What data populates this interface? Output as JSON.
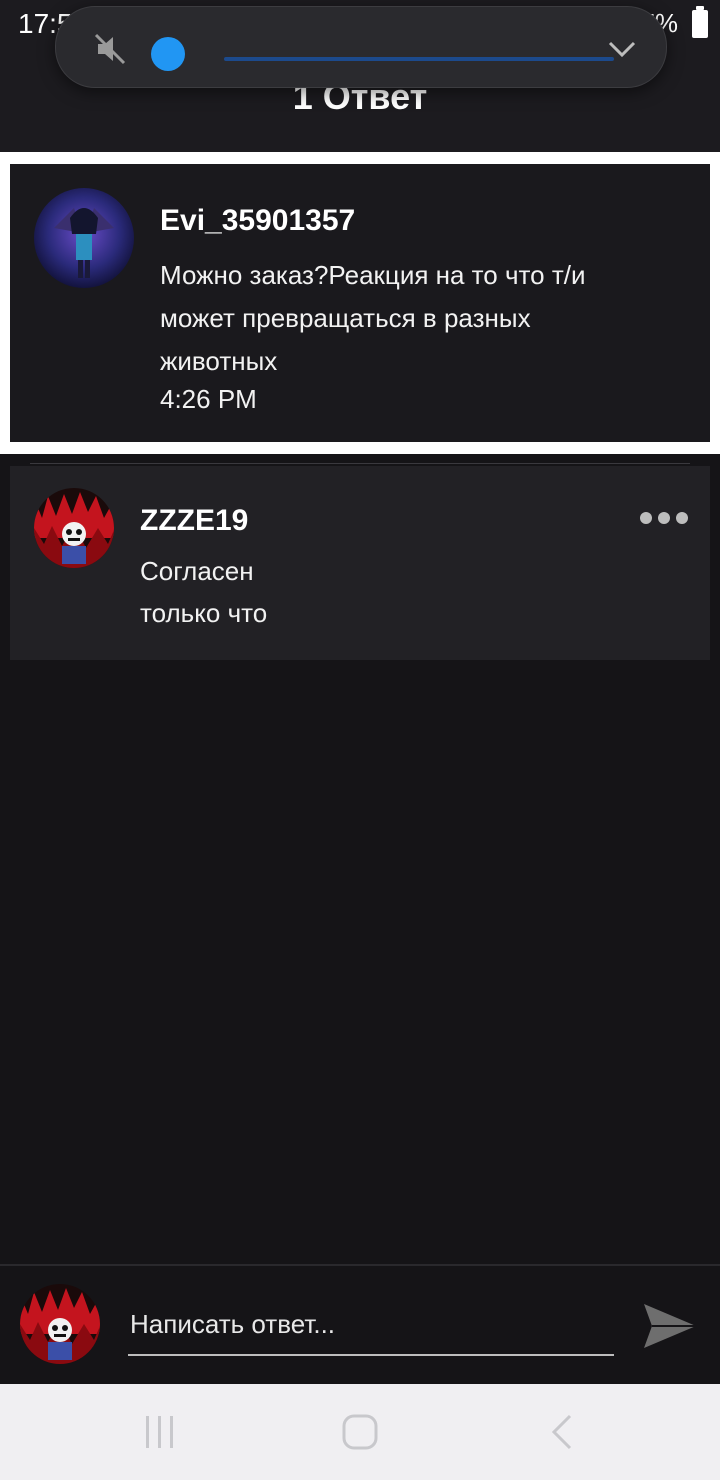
{
  "status": {
    "time": "17:57",
    "battery": "97%"
  },
  "header": {
    "title": "1 Ответ"
  },
  "volume": {
    "level": 0.04
  },
  "comment": {
    "username": "Evi_35901357",
    "text": "Можно заказ?Реакция на то что т/и может превращаться в разных животных",
    "time": "4:26 PM"
  },
  "reply": {
    "username": "ZZZE19",
    "text": "Согласен",
    "time": "только что"
  },
  "composer": {
    "placeholder": "Написать ответ..."
  },
  "icons": {
    "mute": "volume-mute-icon",
    "chevron": "chevron-down-icon",
    "more": "more-horizontal-icon",
    "send": "send-icon",
    "nav_recents": "recents-icon",
    "nav_home": "home-icon",
    "nav_back": "back-icon"
  },
  "colors": {
    "accent": "#2196f3",
    "background": "#151417"
  }
}
